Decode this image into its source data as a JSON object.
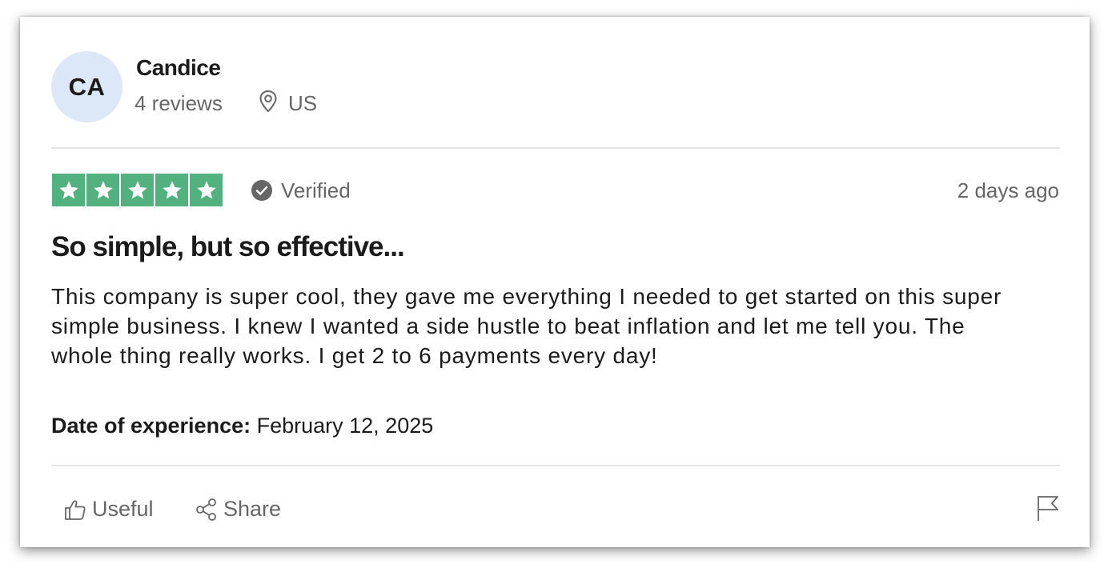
{
  "reviewer": {
    "initials": "CA",
    "name": "Candice",
    "reviews_count": "4 reviews",
    "location": "US",
    "location_icon": "location-pin-icon"
  },
  "review": {
    "rating": 5,
    "rating_max": 5,
    "star_color": "#53b07f",
    "verified_label": "Verified",
    "posted": "2 days ago",
    "title": "So simple, but so effective...",
    "body": "This company is super cool, they gave me everything I needed to get started on this super simple business. I knew I wanted a side hustle to beat inflation and let me tell you. The whole thing really works. I get 2 to 6 payments every day!",
    "experience_label": "Date of experience:",
    "experience_date": "February 12, 2025"
  },
  "actions": {
    "useful_label": "Useful",
    "share_label": "Share",
    "useful_icon": "thumbs-up-icon",
    "share_icon": "share-icon",
    "flag_icon": "flag-icon"
  }
}
